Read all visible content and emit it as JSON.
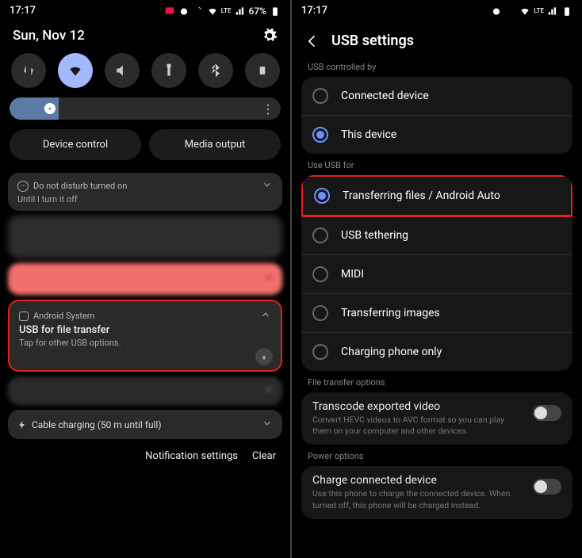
{
  "left": {
    "status": {
      "time": "17:17",
      "battery": "67%"
    },
    "date": "Sun, Nov 12",
    "controls": {
      "device": "Device control",
      "media": "Media output"
    },
    "dnd": {
      "title": "Do not disturb turned on",
      "sub": "Until I turn it off"
    },
    "usb_notif": {
      "app": "Android System",
      "title": "USB for file transfer",
      "sub": "Tap for other USB options."
    },
    "charging": "Cable charging (50 m until full)",
    "bottom": {
      "settings": "Notification settings",
      "clear": "Clear"
    }
  },
  "right": {
    "status": {
      "time": "17:17"
    },
    "header": "USB settings",
    "section1": "USB controlled by",
    "radios1": [
      {
        "label": "Connected device",
        "checked": false
      },
      {
        "label": "This device",
        "checked": true
      }
    ],
    "section2": "Use USB for",
    "radios2": [
      {
        "label": "Transferring files / Android Auto",
        "checked": true,
        "highlight": true
      },
      {
        "label": "USB tethering",
        "checked": false
      },
      {
        "label": "MIDI",
        "checked": false
      },
      {
        "label": "Transferring images",
        "checked": false
      },
      {
        "label": "Charging phone only",
        "checked": false
      }
    ],
    "section3": "File transfer options",
    "transcode": {
      "title": "Transcode exported video",
      "sub": "Convert HEVC videos to AVC format so you can play them on your computer and other devices."
    },
    "section4": "Power options",
    "charge": {
      "title": "Charge connected device",
      "sub": "Use this phone to charge the connected device. When turned off, this phone will be charged instead."
    }
  }
}
